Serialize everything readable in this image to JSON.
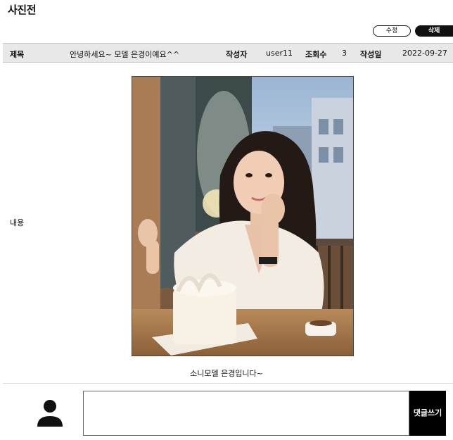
{
  "page": {
    "title": "사진전"
  },
  "actions": {
    "edit_label": "수정",
    "delete_label": "삭제"
  },
  "post": {
    "title_label": "제목",
    "title_value": "안녕하세요~ 모델 은경이예요^^",
    "author_label": "작성자",
    "author_value": "user11",
    "views_label": "조회수",
    "views_value": "3",
    "date_label": "작성일",
    "date_value": "2022-09-27",
    "content_label": "내용",
    "caption": "소니모델 은경입니다~"
  },
  "comment": {
    "submit_label": "댓글쓰기",
    "placeholder": ""
  },
  "icons": {
    "avatar": "user-icon"
  }
}
